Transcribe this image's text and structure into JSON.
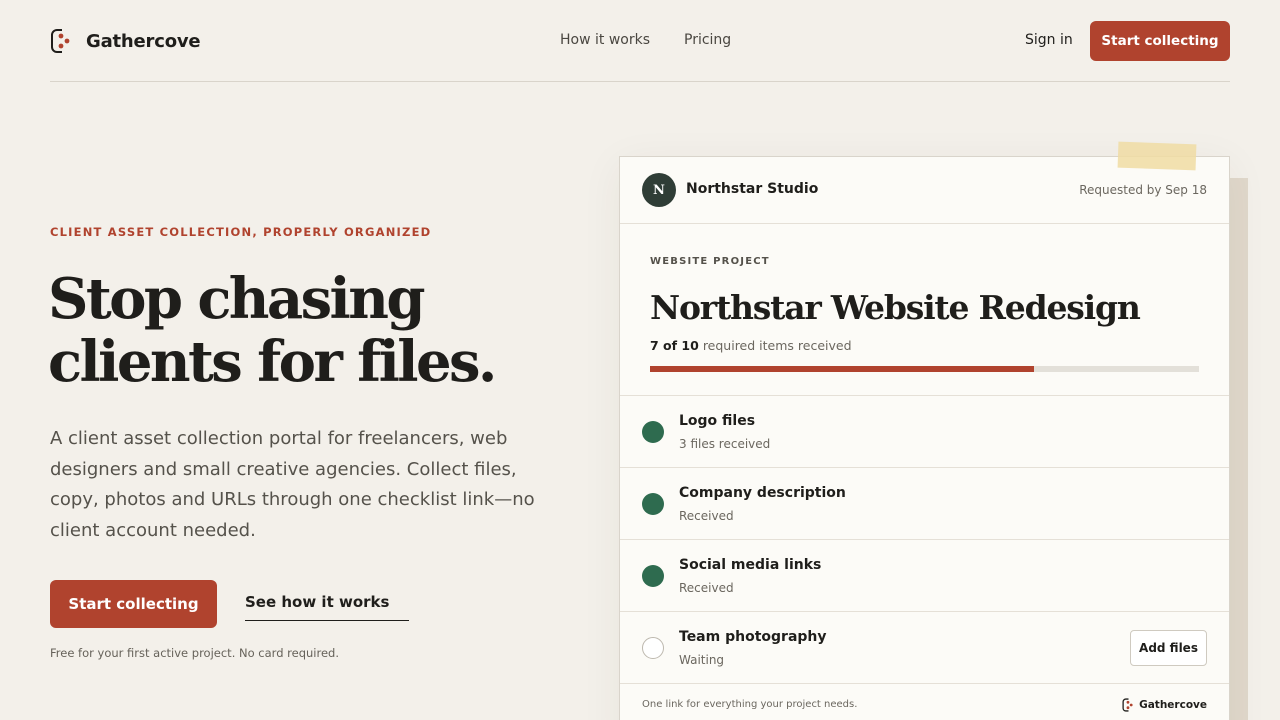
{
  "header": {
    "brand": "Gathercove",
    "nav": [
      "How it works",
      "Pricing"
    ],
    "signin": "Sign in",
    "cta": "Start collecting"
  },
  "hero": {
    "eyebrow": "CLIENT ASSET COLLECTION, PROPERLY ORGANIZED",
    "title_line1": "Stop chasing",
    "title_line2": "clients for files.",
    "subtitle": "A client asset collection portal for freelancers, web designers and small creative agencies. Collect files, copy, photos and URLs through one checklist link—no client account needed.",
    "primary_cta": "Start collecting",
    "secondary_cta": "See how it works",
    "note": "Free for your first active project. No card required."
  },
  "card": {
    "avatar_letter": "N",
    "studio": "Northstar Studio",
    "requested": "Requested by Sep 18",
    "project_eyebrow": "WEBSITE PROJECT",
    "project_title": "Northstar Website Redesign",
    "progress_count": "7 of 10",
    "progress_suffix": "required items received",
    "progress_fraction": 0.7,
    "items": [
      {
        "title": "Logo files",
        "status": "3 files received",
        "done": true
      },
      {
        "title": "Company description",
        "status": "Received",
        "done": true
      },
      {
        "title": "Social media links",
        "status": "Received",
        "done": true
      },
      {
        "title": "Team photography",
        "status": "Waiting",
        "done": false,
        "action": "Add files"
      }
    ],
    "footer_note": "One link for everything your project needs.",
    "footer_brand": "Gathercove"
  },
  "colors": {
    "accent": "#b0432e",
    "done": "#2e6b4f",
    "background": "#f3f0ea"
  }
}
